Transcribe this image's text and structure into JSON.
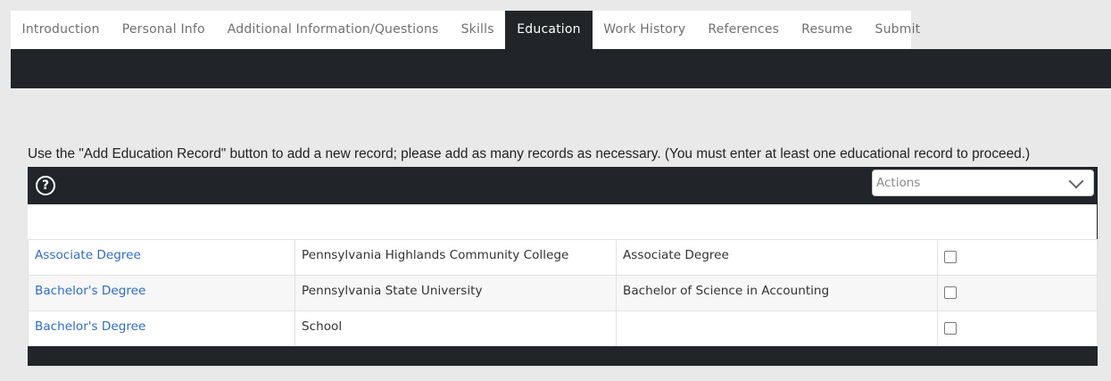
{
  "tabs": [
    {
      "label": "Introduction"
    },
    {
      "label": "Personal Info"
    },
    {
      "label": "Additional Information/Questions"
    },
    {
      "label": "Skills"
    },
    {
      "label": "Education"
    },
    {
      "label": "Work History"
    },
    {
      "label": "References"
    },
    {
      "label": "Resume"
    },
    {
      "label": "Submit"
    }
  ],
  "active_tab": "Education",
  "instructions": "Use the \"Add Education Record\" button to add a new record; please add as many records as necessary.  (You must enter at least one educational record to proceed.)",
  "toolbar": {
    "help_icon": "question-circle-icon",
    "help_glyph": "?",
    "actions_label": "Actions"
  },
  "rows": [
    {
      "degree": "Associate Degree",
      "school": "Pennsylvania Highlands Community College",
      "program": "Associate Degree",
      "checked": false
    },
    {
      "degree": "Bachelor's Degree",
      "school": "Pennsylvania State University",
      "program": "Bachelor of Science in Accounting",
      "checked": false
    },
    {
      "degree": "Bachelor's Degree",
      "school": "School",
      "program": "",
      "checked": false
    }
  ],
  "colors": {
    "dark": "#212429",
    "link": "#2f6cc5",
    "background": "#e9e9e9"
  }
}
